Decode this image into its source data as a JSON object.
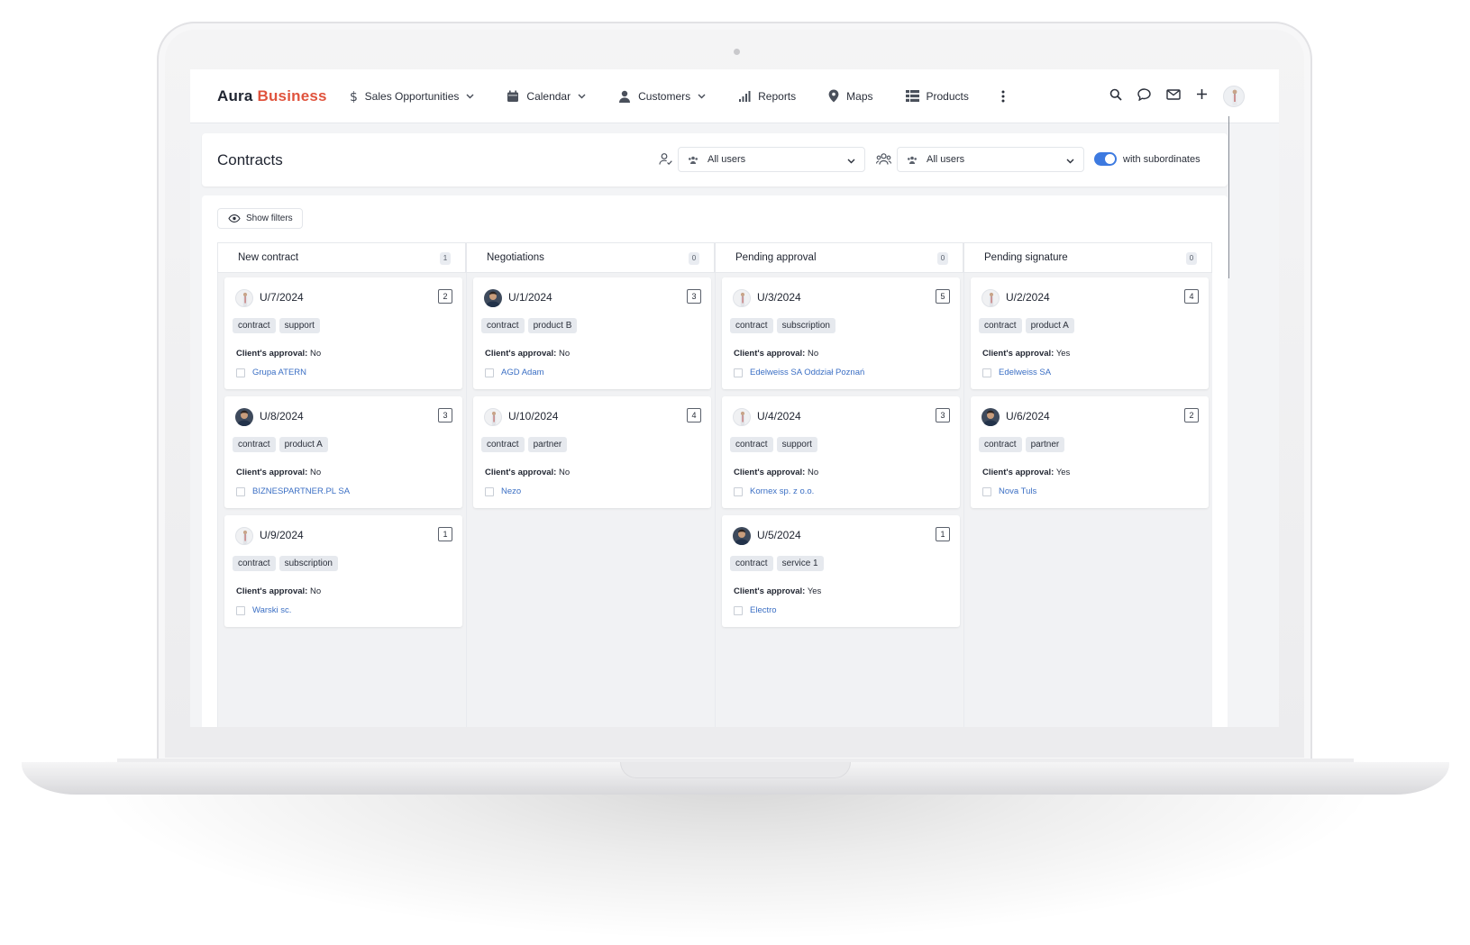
{
  "brand": {
    "part1": "Aura",
    "part2": "Business"
  },
  "nav": [
    {
      "label": "Sales Opportunities",
      "icon": "dollar-icon",
      "dropdown": true
    },
    {
      "label": "Calendar",
      "icon": "calendar-icon",
      "dropdown": true
    },
    {
      "label": "Customers",
      "icon": "user-icon",
      "dropdown": true
    },
    {
      "label": "Reports",
      "icon": "bar-chart-icon",
      "dropdown": false
    },
    {
      "label": "Maps",
      "icon": "map-pin-icon",
      "dropdown": false
    },
    {
      "label": "Products",
      "icon": "list-icon",
      "dropdown": false
    }
  ],
  "nav_right_icons": [
    "search-icon",
    "chat-icon",
    "mail-icon",
    "plus-icon",
    "avatar"
  ],
  "page": {
    "title": "Contracts",
    "owner_select": "All users",
    "team_select": "All users",
    "subordinates_label": "with subordinates",
    "subordinates_on": true,
    "show_filters": "Show filters"
  },
  "colors": {
    "brand_accent": "#e0533d",
    "toggle": "#3d7ae0",
    "link": "#3b6fc4"
  },
  "columns": [
    {
      "title": "New contract",
      "count": "1",
      "cards": [
        {
          "id": "U/7/2024",
          "num": "2",
          "avatar": "light",
          "tags": [
            "contract",
            "support"
          ],
          "approval_label": "Client's approval:",
          "approval": "No",
          "client": "Grupa ATERN"
        },
        {
          "id": "U/8/2024",
          "num": "3",
          "avatar": "dark",
          "tags": [
            "contract",
            "product A"
          ],
          "approval_label": "Client's approval:",
          "approval": "No",
          "client": "BIZNESPARTNER.PL SA"
        },
        {
          "id": "U/9/2024",
          "num": "1",
          "avatar": "light",
          "tags": [
            "contract",
            "subscription"
          ],
          "approval_label": "Client's approval:",
          "approval": "No",
          "client": "Warski sc."
        }
      ]
    },
    {
      "title": "Negotiations",
      "count": "0",
      "cards": [
        {
          "id": "U/1/2024",
          "num": "3",
          "avatar": "dark",
          "tags": [
            "contract",
            "product B"
          ],
          "approval_label": "Client's approval:",
          "approval": "No",
          "client": "AGD Adam"
        },
        {
          "id": "U/10/2024",
          "num": "4",
          "avatar": "light",
          "tags": [
            "contract",
            "partner"
          ],
          "approval_label": "Client's approval:",
          "approval": "No",
          "client": "Nezo"
        }
      ]
    },
    {
      "title": "Pending approval",
      "count": "0",
      "cards": [
        {
          "id": "U/3/2024",
          "num": "5",
          "avatar": "light",
          "tags": [
            "contract",
            "subscription"
          ],
          "approval_label": "Client's approval:",
          "approval": "No",
          "client": "Edelweiss SA Oddział Poznań"
        },
        {
          "id": "U/4/2024",
          "num": "3",
          "avatar": "light",
          "tags": [
            "contract",
            "support"
          ],
          "approval_label": "Client's approval:",
          "approval": "No",
          "client": "Kornex sp. z o.o."
        },
        {
          "id": "U/5/2024",
          "num": "1",
          "avatar": "dark",
          "tags": [
            "contract",
            "service 1"
          ],
          "approval_label": "Client's approval:",
          "approval": "Yes",
          "client": "Electro"
        }
      ]
    },
    {
      "title": "Pending signature",
      "count": "0",
      "cards": [
        {
          "id": "U/2/2024",
          "num": "4",
          "avatar": "light",
          "tags": [
            "contract",
            "product A"
          ],
          "approval_label": "Client's approval:",
          "approval": "Yes",
          "client": "Edelweiss SA"
        },
        {
          "id": "U/6/2024",
          "num": "2",
          "avatar": "dark",
          "tags": [
            "contract",
            "partner"
          ],
          "approval_label": "Client's approval:",
          "approval": "Yes",
          "client": "Nova Tuls"
        }
      ]
    }
  ]
}
